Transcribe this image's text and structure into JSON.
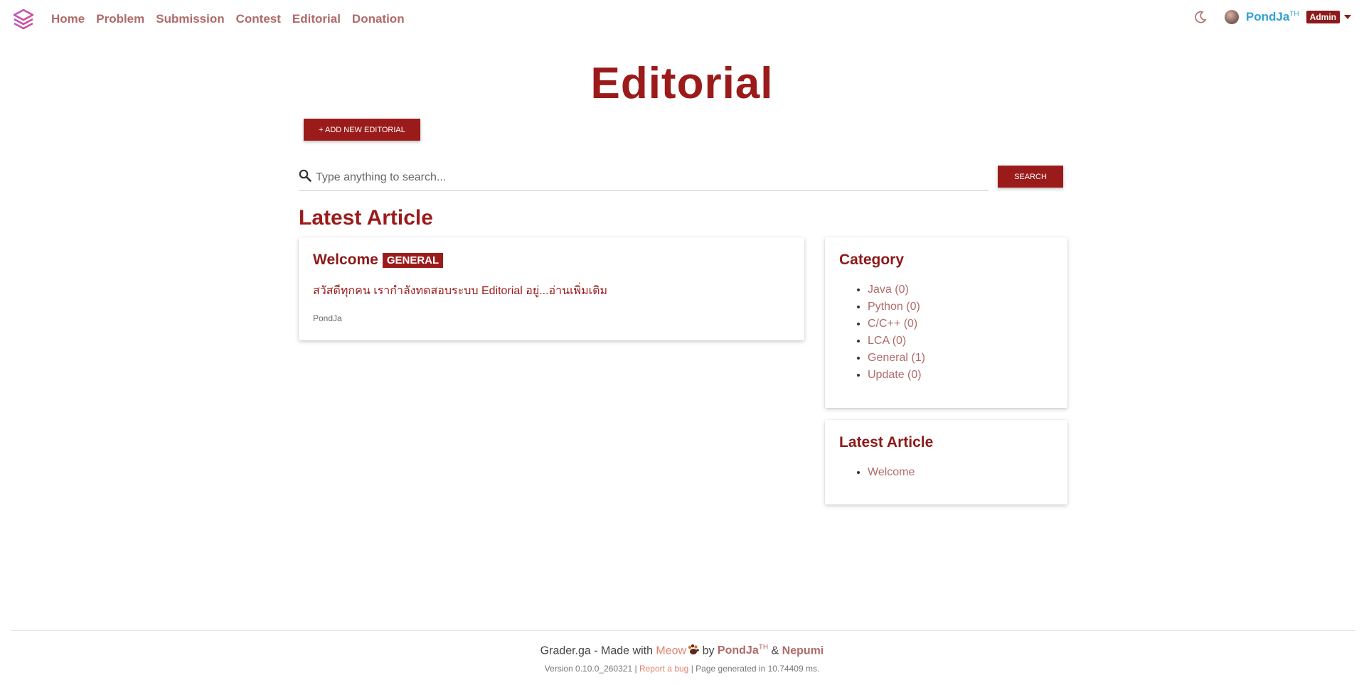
{
  "nav": {
    "links": [
      "Home",
      "Problem",
      "Submission",
      "Contest",
      "Editorial",
      "Donation"
    ],
    "user": {
      "name": "PondJa",
      "sup": "TH",
      "role": "Admin"
    }
  },
  "page": {
    "title": "Editorial",
    "add_button": "+ ADD NEW EDITORIAL"
  },
  "search": {
    "placeholder": "Type anything to search...",
    "button": "SEARCH"
  },
  "latest_section_title": "Latest Article",
  "article": {
    "title": "Welcome",
    "tag": "GENERAL",
    "excerpt": "สวัสดีทุกคน เรากำลังทดสอบระบบ Editorial อยู่...อ่านเพิ่มเติม",
    "author": "PondJa"
  },
  "category": {
    "title": "Category",
    "items": [
      "Java (0)",
      "Python (0)",
      "C/C++ (0)",
      "LCA (0)",
      "General (1)",
      "Update (0)"
    ]
  },
  "latest_sidebar": {
    "title": "Latest Article",
    "items": [
      "Welcome"
    ]
  },
  "footer": {
    "site": "Grader.ga - Made with",
    "meow": "Meow",
    "by": "by",
    "author1": "PondJa",
    "author1_sup": "TH",
    "amp": "&",
    "author2": "Nepumi",
    "version": "Version 0.10.0_260321",
    "sep": "|",
    "report": "Report a bug",
    "generated": "Page generated in 10.74409 ms."
  },
  "colors": {
    "primary": "#9b1b1b",
    "link": "#b06a6a",
    "username": "#2fa3d6",
    "meow": "#e0826b"
  },
  "icons": [
    "logo-icon",
    "moon-icon",
    "avatar",
    "caret-down-icon",
    "search-icon",
    "paw-icon"
  ]
}
